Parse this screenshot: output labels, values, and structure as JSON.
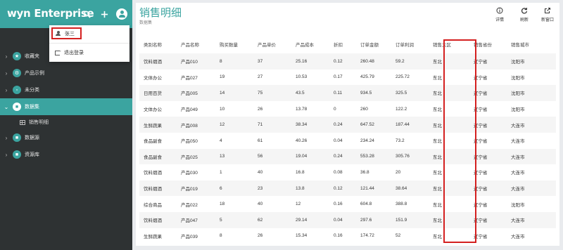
{
  "app": {
    "logo": "wyn Enterprise"
  },
  "header_icons": {
    "search": "search-icon",
    "add": "plus-icon",
    "user": "user-circle-icon"
  },
  "user_menu": {
    "username": "张三",
    "logout_label": "退出登录"
  },
  "sidebar": {
    "items": [
      {
        "label": "收藏夹",
        "icon": "star-icon",
        "glyph": "★",
        "active": false
      },
      {
        "label": "产品示例",
        "icon": "gear-icon",
        "glyph": "⚙",
        "active": false
      },
      {
        "label": "未分类",
        "icon": "folder-icon",
        "glyph": "▫",
        "active": false
      },
      {
        "label": "数据集",
        "icon": "folder-icon",
        "glyph": "■",
        "active": true
      },
      {
        "label": "数据源",
        "icon": "folder-icon",
        "glyph": "■",
        "active": false
      },
      {
        "label": "资源库",
        "icon": "folder-icon",
        "glyph": "■",
        "active": false
      }
    ],
    "sub_item": {
      "label": "销售明细"
    }
  },
  "page": {
    "title": "销售明细",
    "subtitle": "数据集"
  },
  "toolbar": {
    "details": "详情",
    "refresh": "刷新",
    "new_window": "新窗口"
  },
  "colors": {
    "accent": "#3ba4a0",
    "highlight": "#d42020",
    "sidebar_bg": "#2e3233"
  },
  "table": {
    "columns": [
      "类别名称",
      "产品名称",
      "购买数量",
      "产品单价",
      "产品成本",
      "折扣",
      "订单金额",
      "订单利润",
      "销售大区",
      "销售省份",
      "销售城市"
    ],
    "rows": [
      [
        "饮料烟酒",
        "产品010",
        "8",
        "37",
        "25.16",
        "0.12",
        "260.48",
        "59.2",
        "东北",
        "辽宁省",
        "沈阳市"
      ],
      [
        "文体办公",
        "产品027",
        "19",
        "27",
        "10.53",
        "0.17",
        "425.79",
        "225.72",
        "东北",
        "辽宁省",
        "沈阳市"
      ],
      [
        "日用百货",
        "产品005",
        "14",
        "75",
        "43.5",
        "0.11",
        "934.5",
        "325.5",
        "东北",
        "辽宁省",
        "沈阳市"
      ],
      [
        "文体办公",
        "产品049",
        "10",
        "26",
        "13.78",
        "0",
        "260",
        "122.2",
        "东北",
        "辽宁省",
        "沈阳市"
      ],
      [
        "生鲜蔬果",
        "产品008",
        "12",
        "71",
        "38.34",
        "0.24",
        "647.52",
        "187.44",
        "东北",
        "辽宁省",
        "大连市"
      ],
      [
        "食品副食",
        "产品050",
        "4",
        "61",
        "40.26",
        "0.04",
        "234.24",
        "73.2",
        "东北",
        "辽宁省",
        "大连市"
      ],
      [
        "食品副食",
        "产品025",
        "13",
        "56",
        "19.04",
        "0.24",
        "553.28",
        "305.76",
        "东北",
        "辽宁省",
        "大连市"
      ],
      [
        "饮料烟酒",
        "产品030",
        "1",
        "40",
        "16.8",
        "0.08",
        "36.8",
        "20",
        "东北",
        "辽宁省",
        "大连市"
      ],
      [
        "饮料烟酒",
        "产品019",
        "6",
        "23",
        "13.8",
        "0.12",
        "121.44",
        "38.64",
        "东北",
        "辽宁省",
        "大连市"
      ],
      [
        "综合商品",
        "产品022",
        "18",
        "40",
        "12",
        "0.16",
        "604.8",
        "388.8",
        "东北",
        "辽宁省",
        "沈阳市"
      ],
      [
        "饮料烟酒",
        "产品047",
        "5",
        "62",
        "29.14",
        "0.04",
        "297.6",
        "151.9",
        "东北",
        "辽宁省",
        "大连市"
      ],
      [
        "生鲜蔬果",
        "产品039",
        "8",
        "26",
        "15.34",
        "0.16",
        "174.72",
        "52",
        "东北",
        "辽宁省",
        "大连市"
      ]
    ]
  }
}
